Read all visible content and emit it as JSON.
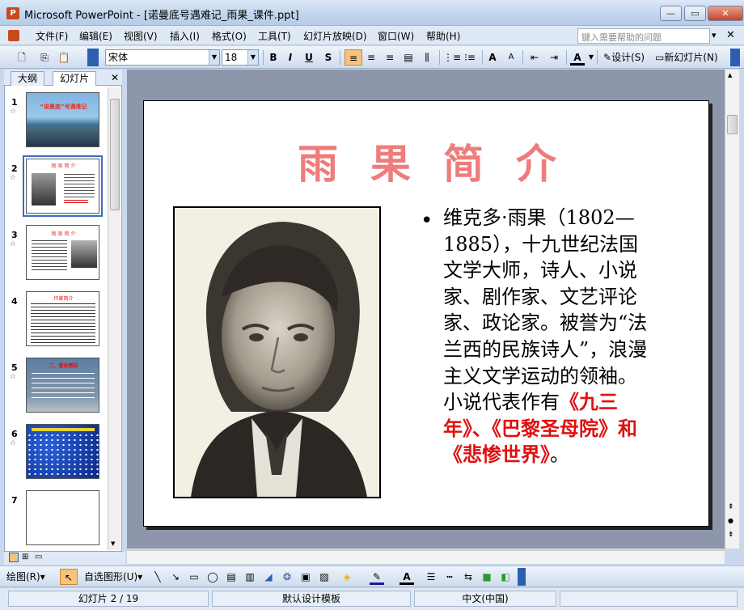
{
  "window": {
    "app_icon_label": "P",
    "title": "Microsoft PowerPoint - [诺曼底号遇难记_雨果_课件.ppt]",
    "minimize": "—",
    "restore": "▭",
    "close": "✕"
  },
  "menubar": {
    "items": [
      "文件(F)",
      "编辑(E)",
      "视图(V)",
      "插入(I)",
      "格式(O)",
      "工具(T)",
      "幻灯片放映(D)",
      "窗口(W)",
      "帮助(H)"
    ],
    "help_placeholder": "键入需要帮助的问题",
    "help_dropdown": "▾",
    "doc_close": "✕"
  },
  "toolbar": {
    "font_name": "宋体",
    "font_size": "18",
    "bold": "B",
    "italic": "I",
    "underline": "U",
    "shadow": "S",
    "grow_font": "A",
    "shrink_font": "A",
    "font_color": "A",
    "design_label": "设计(S)",
    "new_slide_label": "新幻灯片(N)"
  },
  "left_pane": {
    "tab_outline": "大纲",
    "tab_slides": "幻灯片",
    "close": "✕",
    "slides": [
      {
        "num": "1",
        "title": "“诺曼底”号遇难记"
      },
      {
        "num": "2",
        "title": "雨 果 简 介"
      },
      {
        "num": "3",
        "title": "雨 果 简 介"
      },
      {
        "num": "4",
        "title": "作家简介"
      },
      {
        "num": "5",
        "title": "二、整体感知"
      },
      {
        "num": "6",
        "title": ""
      },
      {
        "num": "7",
        "title": ""
      }
    ],
    "star": "☆"
  },
  "slide": {
    "title": "雨果简介",
    "bullet": "•",
    "body_plain": "维克多·雨果（1802—1885），十九世纪法国文学大师，诗人、小说家、剧作家、文艺评论家、政论家。被誉为“法兰西的民族诗人”，浪漫主义文学运动的领袖。小说代表作有",
    "body_red": "《九三年》、《巴黎圣母院》和《悲惨世界》",
    "body_end": "。"
  },
  "drawbar": {
    "draw_label": "绘图(R)",
    "autoshape_label": "自选图形(U)"
  },
  "statusbar": {
    "slide_pos": "幻灯片 2 / 19",
    "template": "默认设计模板",
    "language": "中文(中国)"
  },
  "colors": {
    "title_pink": "#ef7c7c",
    "highlight_red": "#e01010",
    "selection_blue": "#3a6cc4"
  }
}
